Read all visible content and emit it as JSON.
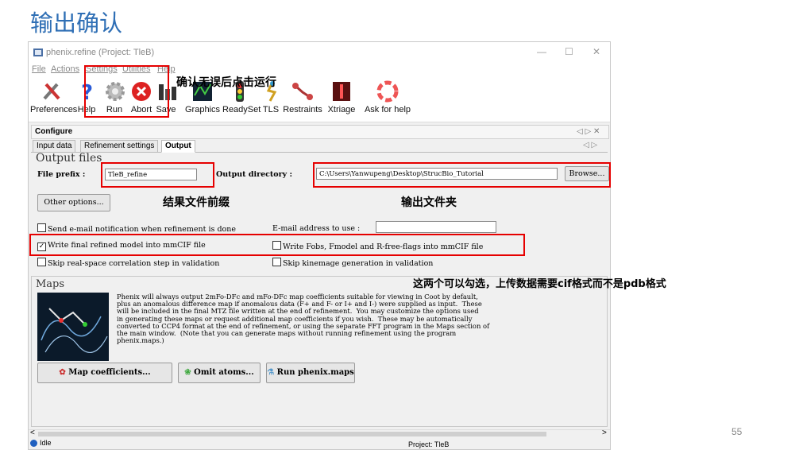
{
  "slide": {
    "title": "输出确认",
    "page_number": "55"
  },
  "window": {
    "title": "phenix.refine (Project: TleB)",
    "controls": {
      "minimize": "—",
      "maximize": "☐",
      "close": "✕"
    }
  },
  "menu": [
    "File",
    "Actions",
    "Settings",
    "Utilities",
    "Help"
  ],
  "toolbar": [
    {
      "label": "Preferences",
      "icon": "wrench-screwdriver-icon"
    },
    {
      "label": "Help",
      "icon": "question-icon"
    },
    {
      "label": "Run",
      "icon": "gear-icon"
    },
    {
      "label": "Abort",
      "icon": "abort-icon"
    },
    {
      "label": "Save",
      "icon": "save-icon"
    },
    {
      "label": "Graphics",
      "icon": "graphics-icon"
    },
    {
      "label": "ReadySet",
      "icon": "readyset-icon"
    },
    {
      "label": "TLS",
      "icon": "tls-icon"
    },
    {
      "label": "Restraints",
      "icon": "restraints-icon"
    },
    {
      "label": "Xtriage",
      "icon": "xtriage-icon"
    },
    {
      "label": "Ask for help",
      "icon": "lifebuoy-icon"
    }
  ],
  "configure_tab": {
    "label": "Configure",
    "controls": "◁ ▷ ✕"
  },
  "tabs": {
    "items": [
      "Input data",
      "Refinement settings",
      "Output"
    ],
    "active": "Output",
    "nav": "◁ ▷"
  },
  "output_files": {
    "heading": "Output files",
    "file_prefix_label": "File prefix :",
    "file_prefix_value": "TleB_refine",
    "output_dir_label": "Output directory :",
    "output_dir_value": "C:\\Users\\Yanwupeng\\Desktop\\StrucBio_Tutorial",
    "browse_label": "Browse...",
    "other_options_label": "Other options..."
  },
  "options": {
    "send_email": {
      "label": "Send e-mail notification when refinement is done",
      "checked": false
    },
    "email_label": "E-mail address to use :",
    "write_mmcif": {
      "label": "Write final refined model into mmCIF file",
      "checked": true
    },
    "write_fobs": {
      "label": "Write Fobs, Fmodel and R-free-flags into mmCIF file",
      "checked": false
    },
    "skip_realspace": {
      "label": "Skip real-space correlation step in validation",
      "checked": false
    },
    "skip_kinemage": {
      "label": "Skip kinemage generation in validation",
      "checked": false
    }
  },
  "maps": {
    "heading": "Maps",
    "lines": [
      "Phenix will always output 2mFo-DFc and mFo-DFc map coefficients suitable for viewing in Coot by default,",
      "plus an anomalous difference map if anomalous data (F+ and F- or I+ and I-) were supplied as input.  These",
      "will be included in the final MTZ file written at the end of refinement.  You may customize the options used",
      "in generating these maps or request additional map coefficients if you wish.  These may be automatically",
      "converted to CCP4 format at the end of refinement, or using the separate FFT program in the Maps section of",
      "the main window.  (Note that you can generate maps without running refinement using the program",
      "phenix.maps.)"
    ],
    "buttons": [
      "Map coefficients...",
      "Omit atoms...",
      "Run phenix.maps"
    ]
  },
  "status": {
    "state": "Idle",
    "project": "Project: TleB",
    "scroll_left": "<",
    "scroll_right": ">"
  },
  "annotations": {
    "run_note": "确认无误后点击运行",
    "prefix_note": "结果文件前缀",
    "folder_note": "输出文件夹",
    "mmcif_note": "这两个可以勾选，上传数据需要cif格式而不是pdb格式"
  },
  "colors": {
    "highlight": "#e60000",
    "title_blue": "#2f6fb5",
    "status_dot": "#1f5fbf"
  }
}
